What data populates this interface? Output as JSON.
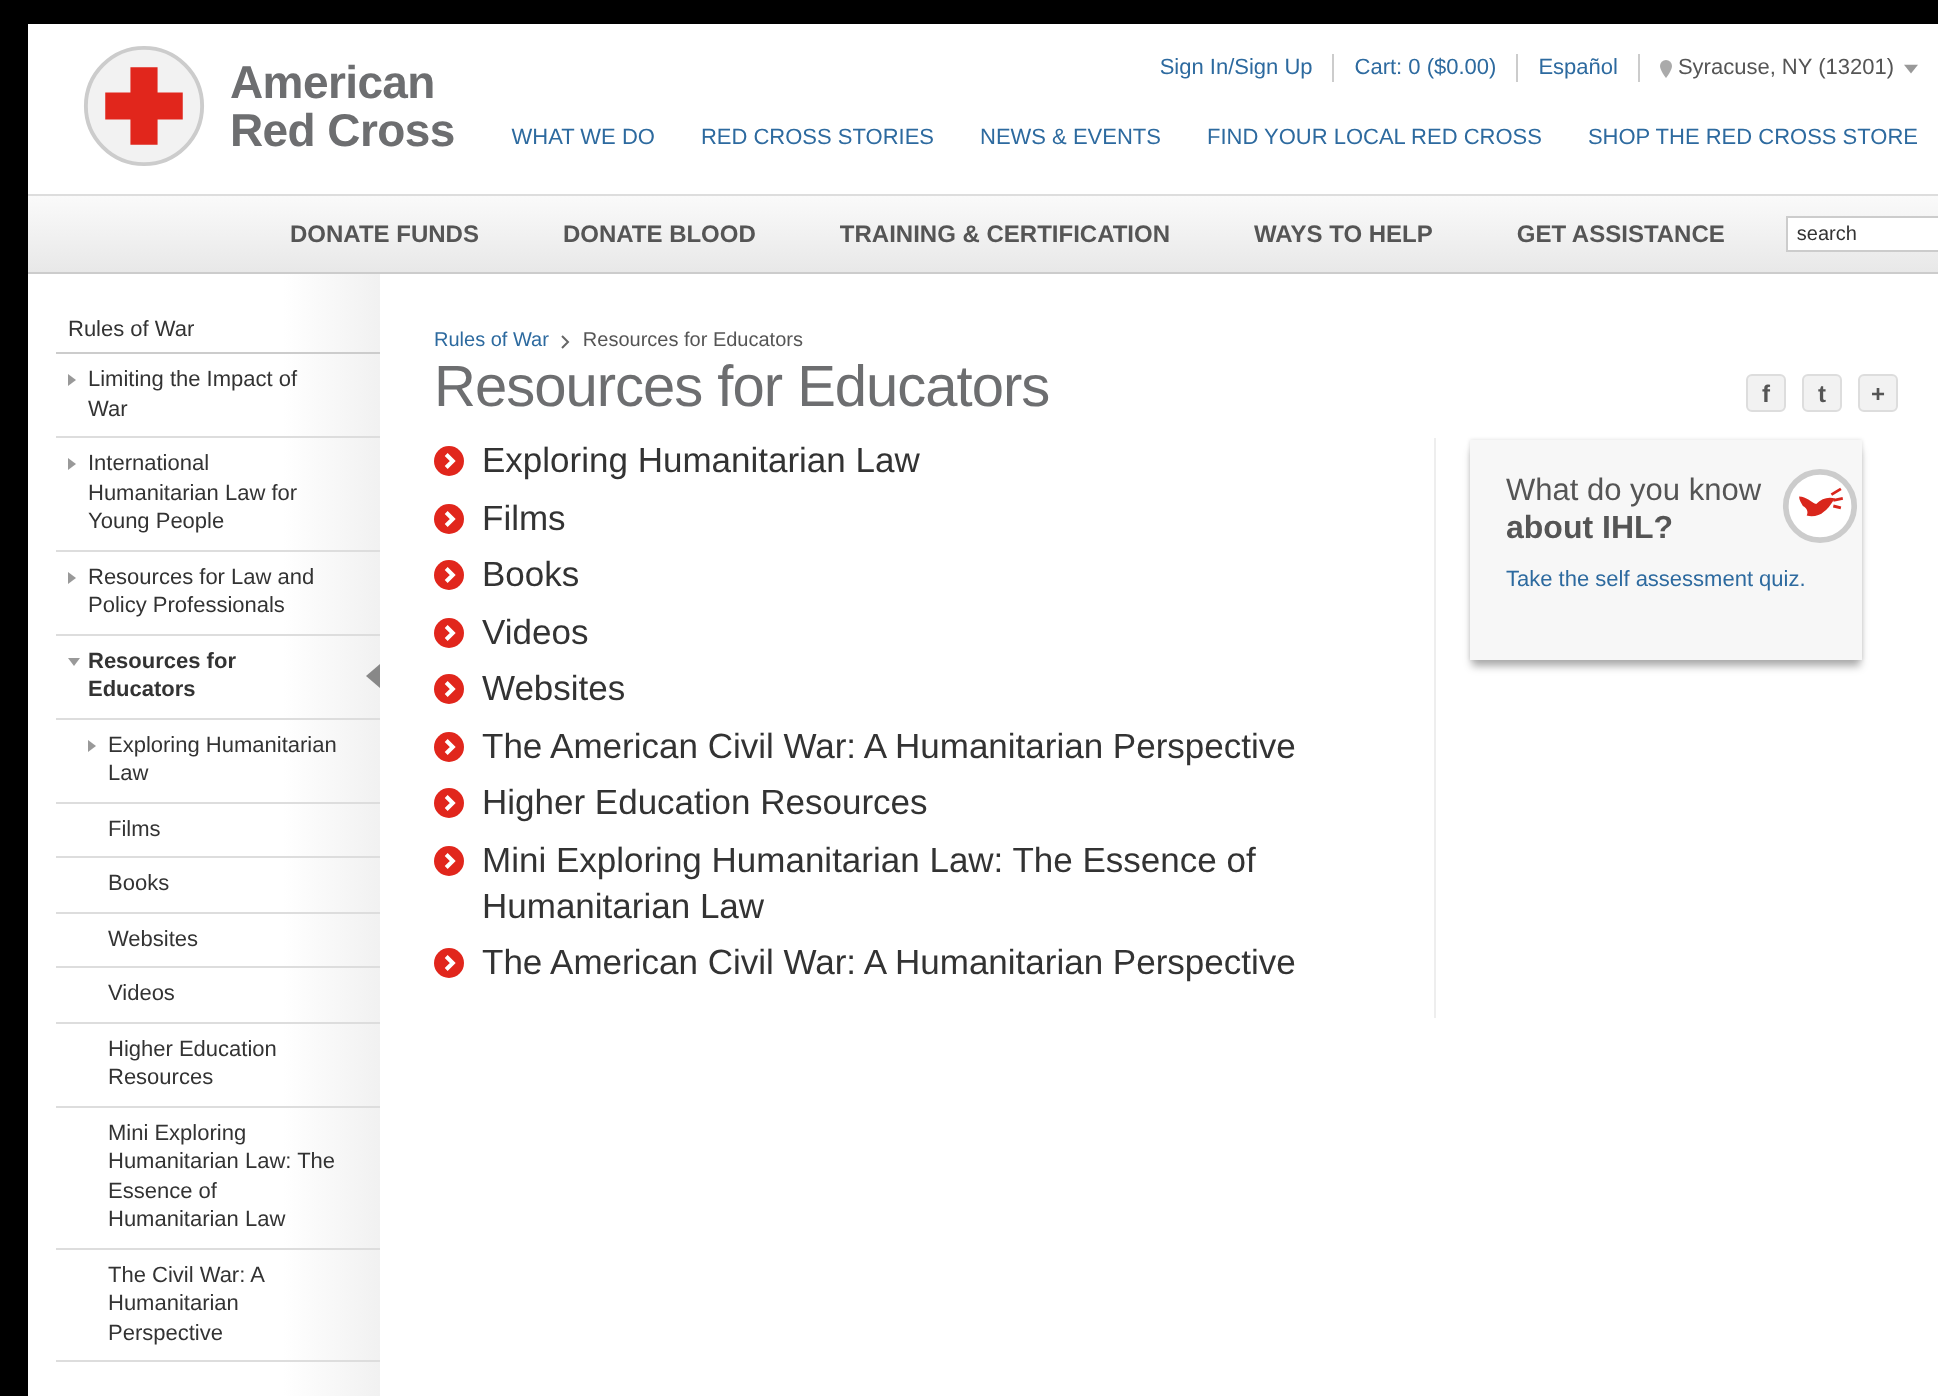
{
  "logo": {
    "line_1": "American",
    "line_2": "Red Cross"
  },
  "utility_links": [
    {
      "label": "Sign In/Sign Up",
      "kind": "link"
    },
    {
      "label": "Cart: 0 ($0.00)",
      "kind": "link"
    },
    {
      "label": "Español",
      "kind": "link"
    },
    {
      "label": "Syracuse, NY (13201)",
      "kind": "location"
    }
  ],
  "top_nav": [
    "WHAT WE DO",
    "RED CROSS STORIES",
    "NEWS & EVENTS",
    "FIND YOUR LOCAL RED CROSS",
    "SHOP THE RED CROSS STORE"
  ],
  "main_nav": [
    "DONATE FUNDS",
    "DONATE BLOOD",
    "TRAINING & CERTIFICATION",
    "WAYS TO HELP",
    "GET ASSISTANCE"
  ],
  "search": {
    "placeholder": "search"
  },
  "sidebar": {
    "title": "Rules of War",
    "items": [
      {
        "label": "Limiting the Impact of War",
        "kind": "branch",
        "expanded": false,
        "selected": false
      },
      {
        "label": "International Humanitarian Law for Young People",
        "kind": "branch",
        "expanded": false,
        "selected": false
      },
      {
        "label": "Resources for Law and Policy Professionals",
        "kind": "branch",
        "expanded": false,
        "selected": false
      },
      {
        "label": "Resources for Educators",
        "kind": "branch",
        "expanded": true,
        "selected": true,
        "children": [
          {
            "label": "Exploring Humanitarian Law",
            "kind": "branch",
            "expanded": false,
            "selected": false
          },
          {
            "label": "Films",
            "kind": "leaf",
            "selected": false
          },
          {
            "label": "Books",
            "kind": "leaf",
            "selected": false
          },
          {
            "label": "Websites",
            "kind": "leaf",
            "selected": false
          },
          {
            "label": "Videos",
            "kind": "leaf",
            "selected": false
          },
          {
            "label": "Higher Education Resources",
            "kind": "leaf",
            "selected": false
          },
          {
            "label": "Mini Exploring Humanitarian Law: The Essence of Humanitarian Law",
            "kind": "leaf",
            "selected": false
          },
          {
            "label": "The Civil War: A Humanitarian Perspective",
            "kind": "leaf",
            "selected": false
          }
        ]
      }
    ]
  },
  "breadcrumb": [
    {
      "label": "Rules of War",
      "kind": "link"
    },
    {
      "label": "Resources for Educators",
      "kind": "current"
    }
  ],
  "page_title": "Resources for Educators",
  "social_buttons": [
    "f",
    "t",
    "+"
  ],
  "links": [
    "Exploring Humanitarian Law",
    "Films",
    "Books",
    "Videos",
    "Websites",
    "The American Civil War: A Humanitarian Perspective",
    "Higher Education Resources",
    "Mini Exploring Humanitarian Law: The Essence of Humanitarian Law",
    "The American Civil War: A Humanitarian Perspective"
  ],
  "quiz_card": {
    "line_1": "What do you know",
    "line_2": "about IHL?",
    "link": "Take the self assessment quiz."
  }
}
